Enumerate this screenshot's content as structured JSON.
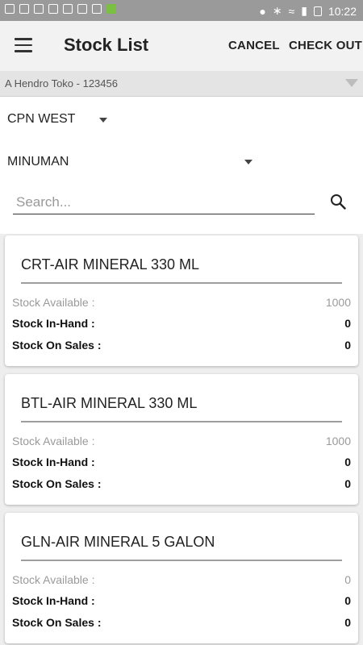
{
  "status_bar": {
    "time": "10:22"
  },
  "header": {
    "title": "Stock List",
    "cancel_label": "CANCEL",
    "checkout_label": "CHECK OUT"
  },
  "store": {
    "text": "A Hendro Toko - 123456"
  },
  "filters": {
    "region": "CPN WEST",
    "area": "MINUMAN",
    "search_placeholder": "Search..."
  },
  "products": [
    {
      "name": "CRT-AIR MINERAL 330 ML",
      "stock_available_label": "Stock Available :",
      "stock_available": "1000",
      "in_hand_label": "Stock In-Hand :",
      "in_hand": "0",
      "on_sales_label": "Stock On Sales :",
      "on_sales": "0"
    },
    {
      "name": "BTL-AIR MINERAL 330 ML",
      "stock_available_label": "Stock Available :",
      "stock_available": "1000",
      "in_hand_label": "Stock In-Hand :",
      "in_hand": "0",
      "on_sales_label": "Stock On Sales :",
      "on_sales": "0"
    },
    {
      "name": "GLN-AIR MINERAL 5 GALON",
      "stock_available_label": "Stock Available :",
      "stock_available": "0",
      "in_hand_label": "Stock In-Hand :",
      "in_hand": "0",
      "on_sales_label": "Stock On Sales :",
      "on_sales": "0"
    }
  ]
}
